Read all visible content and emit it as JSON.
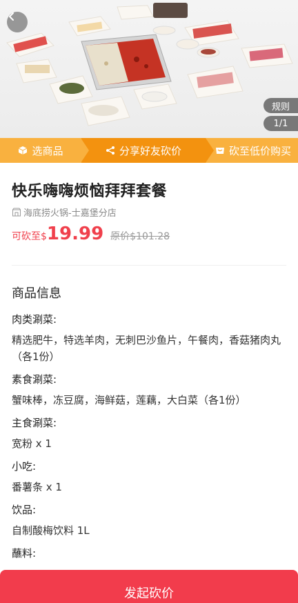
{
  "hero": {
    "rules_label": "规则",
    "page_indicator": "1/1"
  },
  "steps": {
    "step1": "选商品",
    "step2": "分享好友砍价",
    "step3": "砍至低价购买"
  },
  "product": {
    "title": "快乐嗨嗨烦恼拜拜套餐",
    "store": "海底捞火锅-士嘉堡分店",
    "price_prefix": "可砍至",
    "currency": "$",
    "price": "19.99",
    "original_price": "原价$101.28"
  },
  "info": {
    "section_title": "商品信息",
    "items": [
      {
        "category": "肉类涮菜:",
        "detail": "精选肥牛，特选羊肉，无刺巴沙鱼片，午餐肉，香菇猪肉丸（各1份）"
      },
      {
        "category": "素食涮菜:",
        "detail": "蟹味棒，冻豆腐，海鲜菇，莲藕，大白菜（各1份）"
      },
      {
        "category": "主食涮菜:",
        "detail": "宽粉 x 1"
      },
      {
        "category": "小吃:",
        "detail": "番薯条 x 1"
      },
      {
        "category": "饮品:",
        "detail": "自制酸梅饮料 1L"
      },
      {
        "category": "蘸料:",
        "detail": ""
      }
    ]
  },
  "cta": {
    "label": "发起砍价"
  },
  "colors": {
    "accent": "#f23c4c",
    "steps_bg": "#f9b13f",
    "steps_active": "#f3920f"
  }
}
